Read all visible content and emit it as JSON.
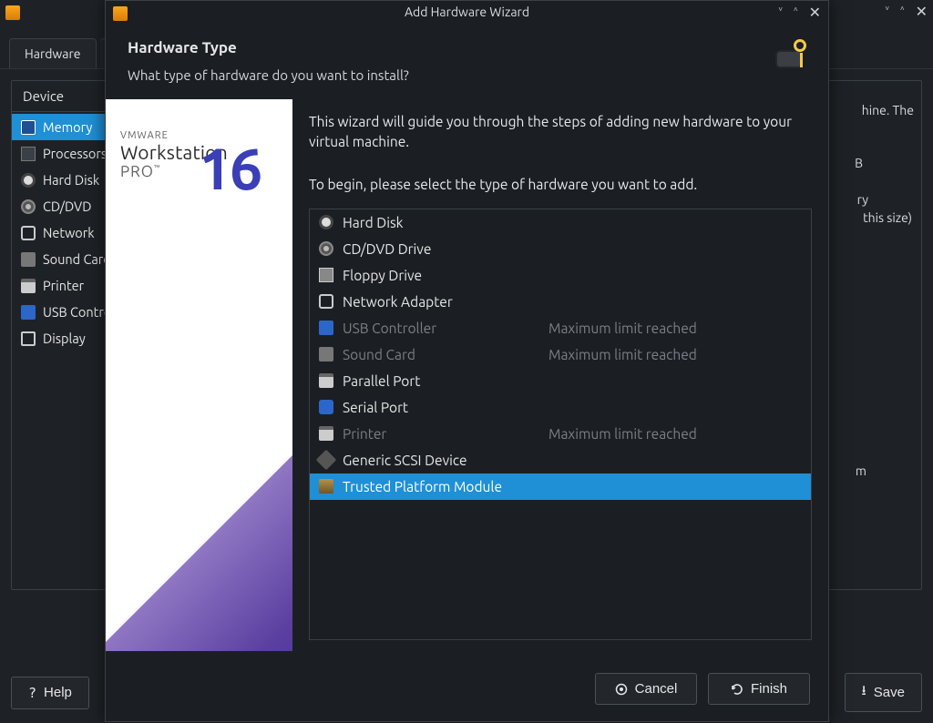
{
  "parent_window": {
    "tabs": [
      "Hardware"
    ],
    "device_panel_header": "Device",
    "devices": [
      {
        "label": "Memory",
        "icon": "memory",
        "selected": true
      },
      {
        "label": "Processors",
        "icon": "proc"
      },
      {
        "label": "Hard Disk",
        "icon": "hdd"
      },
      {
        "label": "CD/DVD",
        "icon": "cd"
      },
      {
        "label": "Network",
        "icon": "net"
      },
      {
        "label": "Sound Card",
        "icon": "sound"
      },
      {
        "label": "Printer",
        "icon": "printer"
      },
      {
        "label": "USB Controller",
        "icon": "usb"
      },
      {
        "label": "Display",
        "icon": "display"
      }
    ],
    "right_fragments": {
      "line1": "hine. The",
      "line2": "B",
      "line3": "ry",
      "line4": "this size)",
      "line5": "m"
    },
    "buttons": {
      "help": "Help",
      "save": "Save"
    }
  },
  "wizard": {
    "title": "Add Hardware Wizard",
    "heading": "Hardware Type",
    "subheading": "What type of hardware do you want to install?",
    "intro": "This wizard will guide you through the steps of adding new hardware to your virtual machine.",
    "begin": "To begin, please select the type of hardware you want to add.",
    "sidebar_brand": {
      "vendor": "VMWARE",
      "product": "Workstation",
      "pro": "PRO",
      "version": "16"
    },
    "hardware_types": [
      {
        "label": "Hard Disk",
        "icon": "hdd",
        "enabled": true
      },
      {
        "label": "CD/DVD Drive",
        "icon": "cd",
        "enabled": true
      },
      {
        "label": "Floppy Drive",
        "icon": "floppy",
        "enabled": true
      },
      {
        "label": "Network Adapter",
        "icon": "net",
        "enabled": true
      },
      {
        "label": "USB Controller",
        "icon": "usb",
        "enabled": false,
        "status": "Maximum limit reached"
      },
      {
        "label": "Sound Card",
        "icon": "sound",
        "enabled": false,
        "status": "Maximum limit reached"
      },
      {
        "label": "Parallel Port",
        "icon": "printer",
        "enabled": true
      },
      {
        "label": "Serial Port",
        "icon": "serial",
        "enabled": true
      },
      {
        "label": "Printer",
        "icon": "printer",
        "enabled": false,
        "status": "Maximum limit reached"
      },
      {
        "label": "Generic SCSI Device",
        "icon": "scsi",
        "enabled": true
      },
      {
        "label": "Trusted Platform Module",
        "icon": "tpm",
        "enabled": true,
        "selected": true
      }
    ],
    "buttons": {
      "cancel": "Cancel",
      "finish": "Finish"
    }
  }
}
